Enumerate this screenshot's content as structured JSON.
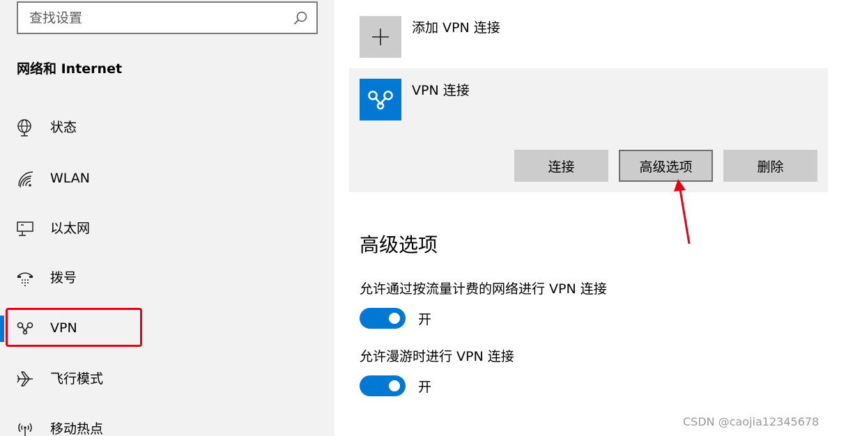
{
  "search": {
    "placeholder": "查找设置"
  },
  "sidebar": {
    "section_title": "网络和 Internet",
    "items": [
      {
        "label": "状态",
        "icon": "globe-icon"
      },
      {
        "label": "WLAN",
        "icon": "wifi-icon"
      },
      {
        "label": "以太网",
        "icon": "ethernet-icon"
      },
      {
        "label": "拨号",
        "icon": "dialup-icon"
      },
      {
        "label": "VPN",
        "icon": "vpn-icon",
        "selected": true
      },
      {
        "label": "飞行模式",
        "icon": "airplane-icon"
      },
      {
        "label": "移动热点",
        "icon": "hotspot-icon"
      }
    ]
  },
  "main": {
    "add_vpn_label": "添加 VPN 连接",
    "vpn_entry": {
      "name": "VPN 连接",
      "buttons": {
        "connect": "连接",
        "advanced": "高级选项",
        "delete": "删除"
      }
    },
    "advanced_title": "高级选项",
    "options": [
      {
        "label": "允许通过按流量计费的网络进行 VPN 连接",
        "state": "开",
        "on": true
      },
      {
        "label": "允许漫游时进行 VPN 连接",
        "state": "开",
        "on": true
      }
    ]
  },
  "watermark": "CSDN @caojia12345678",
  "colors": {
    "accent": "#0078d4",
    "annotation": "#e60012",
    "sidebar_bg": "#f2f2f2"
  }
}
